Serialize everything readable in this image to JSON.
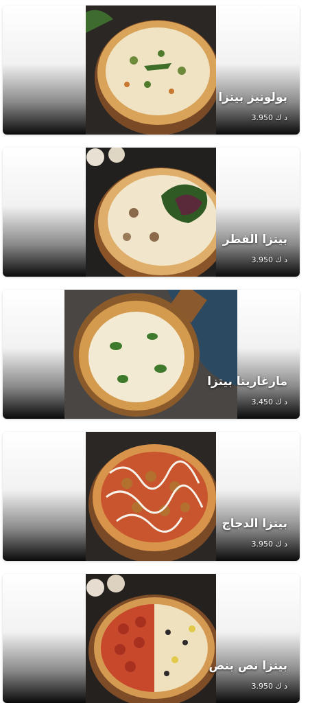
{
  "menu": {
    "items": [
      {
        "name": "بولونيز بيتزا",
        "price": "3.950 د ك",
        "image": "pizza-with-herbs-photo"
      },
      {
        "name": "بيتزا الفطر",
        "price": "3.950 د ك",
        "image": "mushroom-pizza-with-salad-photo"
      },
      {
        "name": "مارغاريتا بيتزا",
        "price": "3.450 د ك",
        "image": "margherita-pizza-on-board-photo"
      },
      {
        "name": "بيتزا الدجاج",
        "price": "3.950 د ك",
        "image": "chicken-pizza-with-mayo-photo"
      },
      {
        "name": "بيتزا نص بنص",
        "price": "3.950 د ك",
        "image": "half-and-half-pizza-photo"
      }
    ]
  }
}
